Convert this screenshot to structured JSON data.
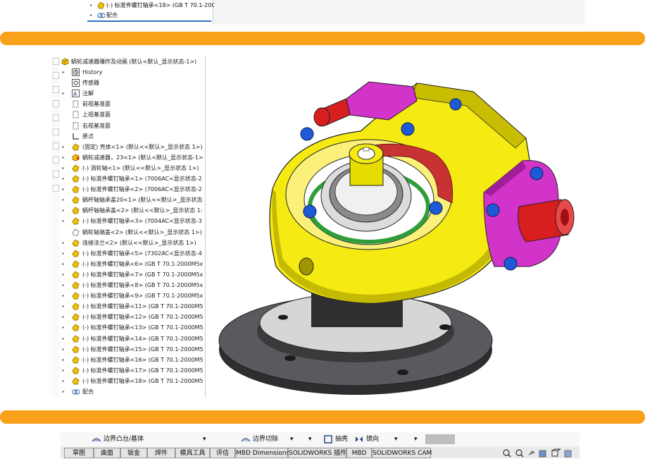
{
  "top_strip": {
    "items": [
      {
        "label": "(-) 标准件螺钉轴承<18> (GB T 70.1-2000M5"
      },
      {
        "label": "配合"
      }
    ],
    "caret": "ˇ"
  },
  "tree": {
    "root": "蜗轮减速器爆炸及动画 (默认<默认_显示状态-1>)",
    "items": [
      {
        "label": "History",
        "arrow": "▸",
        "icon": "history-icon"
      },
      {
        "label": "传感器",
        "arrow": "",
        "icon": "sensor-icon"
      },
      {
        "label": "注解",
        "arrow": "▸",
        "icon": "annotation-icon"
      },
      {
        "label": "前视基准面",
        "arrow": "",
        "icon": "plane-icon"
      },
      {
        "label": "上视基准面",
        "arrow": "",
        "icon": "plane-icon"
      },
      {
        "label": "右视基准面",
        "arrow": "",
        "icon": "plane-icon"
      },
      {
        "label": "原点",
        "arrow": "",
        "icon": "origin-icon"
      },
      {
        "label": "(固定) 壳体<1> (默认<<默认>_显示状态 1>)",
        "arrow": "▸",
        "icon": "part-icon"
      },
      {
        "label": "蜗轮减速器，23<1> (默认<默认_显示状态-1>",
        "arrow": "▸",
        "icon": "assembly-icon"
      },
      {
        "label": "(-) 涡轮轴<1> (默认<<默认>_显示状态 1>)",
        "arrow": "▸",
        "icon": "part-icon"
      },
      {
        "label": "(-) 标准件螺钉轴承<1> (7006AC<显示状态-2",
        "arrow": "▸",
        "icon": "part-icon"
      },
      {
        "label": "(-) 标准件螺钉轴承<2> (7006AC<显示状态-2",
        "arrow": "▸",
        "icon": "part-icon"
      },
      {
        "label": "蜗杆轴轴承盖20<1> (默认<<默认>_显示状态",
        "arrow": "▸",
        "icon": "part-icon"
      },
      {
        "label": "蜗杆轴轴承盖<2> (默认<<默认>_显示状态 1:",
        "arrow": "▸",
        "icon": "part-icon"
      },
      {
        "label": "(-) 标准件螺钉轴承<3> (7004AC<显示状态-3",
        "arrow": "▸",
        "icon": "part-icon"
      },
      {
        "label": "蜗轮轴端盖<2> (默认<<默认>_显示状态 1>)",
        "arrow": "",
        "icon": "suppressed-part-icon"
      },
      {
        "label": "连接法兰<2> (默认<<默认>_显示状态 1>)",
        "arrow": "▸",
        "icon": "part-icon"
      },
      {
        "label": "(-) 标准件螺钉轴承<5> (7302AC<显示状态-4",
        "arrow": "▸",
        "icon": "part-icon"
      },
      {
        "label": "(-) 标准件螺钉轴承<6> (GB T 70.1-2000M5x",
        "arrow": "▸",
        "icon": "part-icon"
      },
      {
        "label": "(-) 标准件螺钉轴承<7> (GB T 70.1-2000M5x",
        "arrow": "▸",
        "icon": "part-icon"
      },
      {
        "label": "(-) 标准件螺钉轴承<8> (GB T 70.1-2000M5x",
        "arrow": "▸",
        "icon": "part-icon"
      },
      {
        "label": "(-) 标准件螺钉轴承<9> (GB T 70.1-2000M5x",
        "arrow": "▸",
        "icon": "part-icon"
      },
      {
        "label": "(-) 标准件螺钉轴承<11> (GB T 70.1-2000M5",
        "arrow": "▸",
        "icon": "part-icon"
      },
      {
        "label": "(-) 标准件螺钉轴承<12> (GB T 70.1-2000M5",
        "arrow": "▸",
        "icon": "part-icon"
      },
      {
        "label": "(-) 标准件螺钉轴承<13> (GB T 70.1-2000M5",
        "arrow": "▸",
        "icon": "part-icon"
      },
      {
        "label": "(-) 标准件螺钉轴承<14> (GB T 70.1-2000M5",
        "arrow": "▸",
        "icon": "part-icon"
      },
      {
        "label": "(-) 标准件螺钉轴承<15> (GB T 70.1-2000M5",
        "arrow": "▸",
        "icon": "part-icon"
      },
      {
        "label": "(-) 标准件螺钉轴承<16> (GB T 70.1-2000M5",
        "arrow": "▸",
        "icon": "part-icon"
      },
      {
        "label": "(-) 标准件螺钉轴承<17> (GB T 70.1-2000M5",
        "arrow": "▸",
        "icon": "part-icon"
      },
      {
        "label": "(-) 标准件螺钉轴承<18> (GB T 70.1-2000M5",
        "arrow": "▸",
        "icon": "part-icon"
      },
      {
        "label": "配合",
        "arrow": "▸",
        "icon": "mates-icon"
      }
    ]
  },
  "toolbar": {
    "boundary_boss": "边界凸台/基体",
    "boundary_cut": "边界切除",
    "shell": "抽壳",
    "mirror": "镜向",
    "dropdown_caret": "▾"
  },
  "tabs": [
    "草图",
    "曲面",
    "钣金",
    "焊件",
    "模具工具",
    "评估",
    "MBD Dimensions",
    "SOLIDWORKS 插件",
    "MBD",
    "SOLIDWORKS CAM"
  ],
  "colors": {
    "accent_bar": "#f9a11b",
    "housing_yellow": "#f5ea12",
    "flange_gray": "#5a5a5e",
    "cover_magenta": "#d233c8",
    "shaft_red": "#d81e1e",
    "bolt_blue": "#1e5ad8",
    "gear_green": "#2e9e3a",
    "gear_red": "#c83232"
  }
}
